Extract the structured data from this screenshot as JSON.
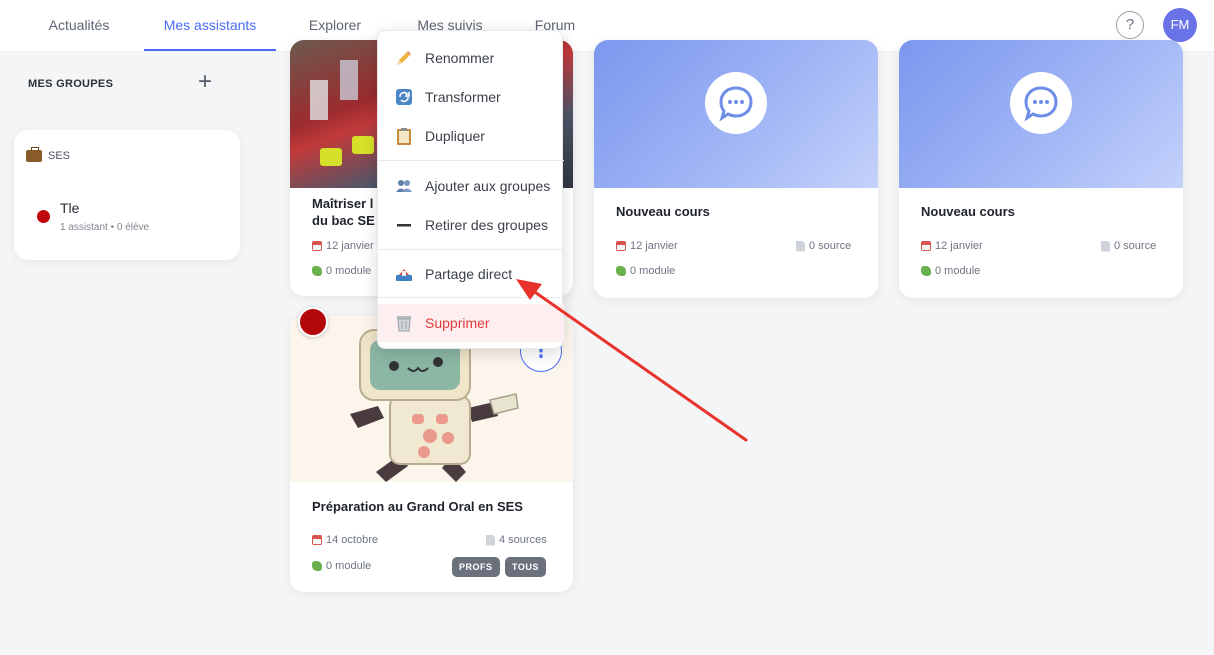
{
  "nav": {
    "tabs": [
      {
        "label": "Actualités"
      },
      {
        "label": "Mes assistants"
      },
      {
        "label": "Explorer"
      },
      {
        "label": "Mes suivis"
      },
      {
        "label": "Forum"
      }
    ],
    "help_label": "?",
    "avatar_initials": "FM"
  },
  "sidebar": {
    "title": "MES GROUPES",
    "add_label": "+",
    "group": {
      "header": "SES",
      "item_name": "Tle",
      "item_meta": "1 assistant • 0 élève"
    }
  },
  "cards": {
    "card1": {
      "title_line1": "Maîtriser l",
      "title_line2": "du bac SE",
      "date": "12 janvier",
      "module": "0 module"
    },
    "card2": {
      "title": "Nouveau cours",
      "date": "12 janvier",
      "sources": "0 source",
      "module": "0 module"
    },
    "card3": {
      "title": "Nouveau cours",
      "date": "12 janvier",
      "sources": "0 source",
      "module": "0 module"
    },
    "card4": {
      "title": "Préparation au Grand Oral en SES",
      "date": "14 octobre",
      "sources": "4 sources",
      "module": "0 module",
      "badges": [
        "PROFS",
        "TOUS"
      ]
    }
  },
  "menu": {
    "items": [
      {
        "label": "Renommer",
        "icon": "pencil-icon"
      },
      {
        "label": "Transformer",
        "icon": "transform-icon"
      },
      {
        "label": "Dupliquer",
        "icon": "clipboard-icon"
      },
      {
        "label": "Ajouter aux groupes",
        "icon": "people-icon"
      },
      {
        "label": "Retirer des groupes",
        "icon": "minus-icon"
      },
      {
        "label": "Partage direct",
        "icon": "share-icon"
      },
      {
        "label": "Supprimer",
        "icon": "trash-icon"
      }
    ]
  },
  "colors": {
    "accent": "#4a6cf7",
    "danger": "#e03a3a",
    "annotation_arrow": "#e8322b",
    "group_dot": "#c0080c"
  }
}
